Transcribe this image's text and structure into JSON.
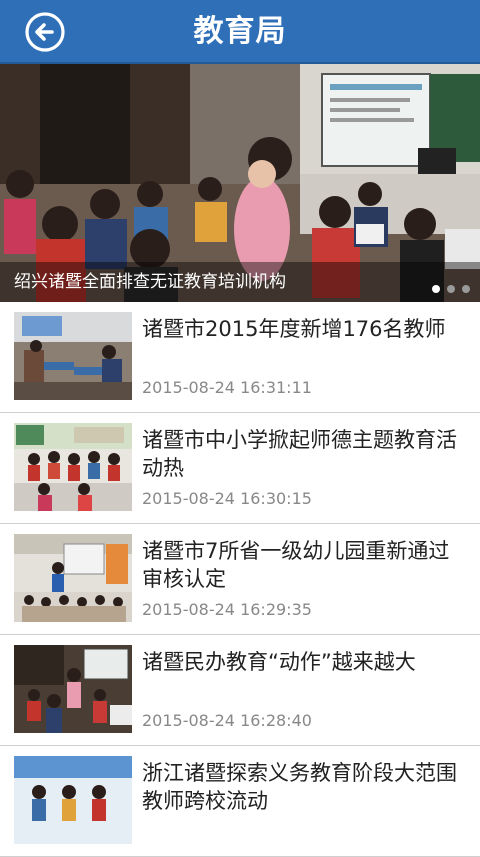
{
  "header": {
    "title": "教育局",
    "back_icon": "back-arrow-circle-icon",
    "color": "#2f6fb8"
  },
  "banner": {
    "caption": "绍兴诸暨全面排查无证教育培训机构",
    "slide_count": 3,
    "active_slide": 1
  },
  "news": [
    {
      "title": "诸暨市2015年度新增176名教师",
      "time": "2015-08-24 16:31:11"
    },
    {
      "title": "诸暨市中小学掀起师德主题教育活动热",
      "time": "2015-08-24 16:30:15"
    },
    {
      "title": "诸暨市7所省一级幼儿园重新通过审核认定",
      "time": "2015-08-24 16:29:35"
    },
    {
      "title": "诸暨民办教育“动作”越来越大",
      "time": "2015-08-24 16:28:40"
    },
    {
      "title": "浙江诸暨探索义务教育阶段大范围教师跨校流动",
      "time": ""
    }
  ]
}
